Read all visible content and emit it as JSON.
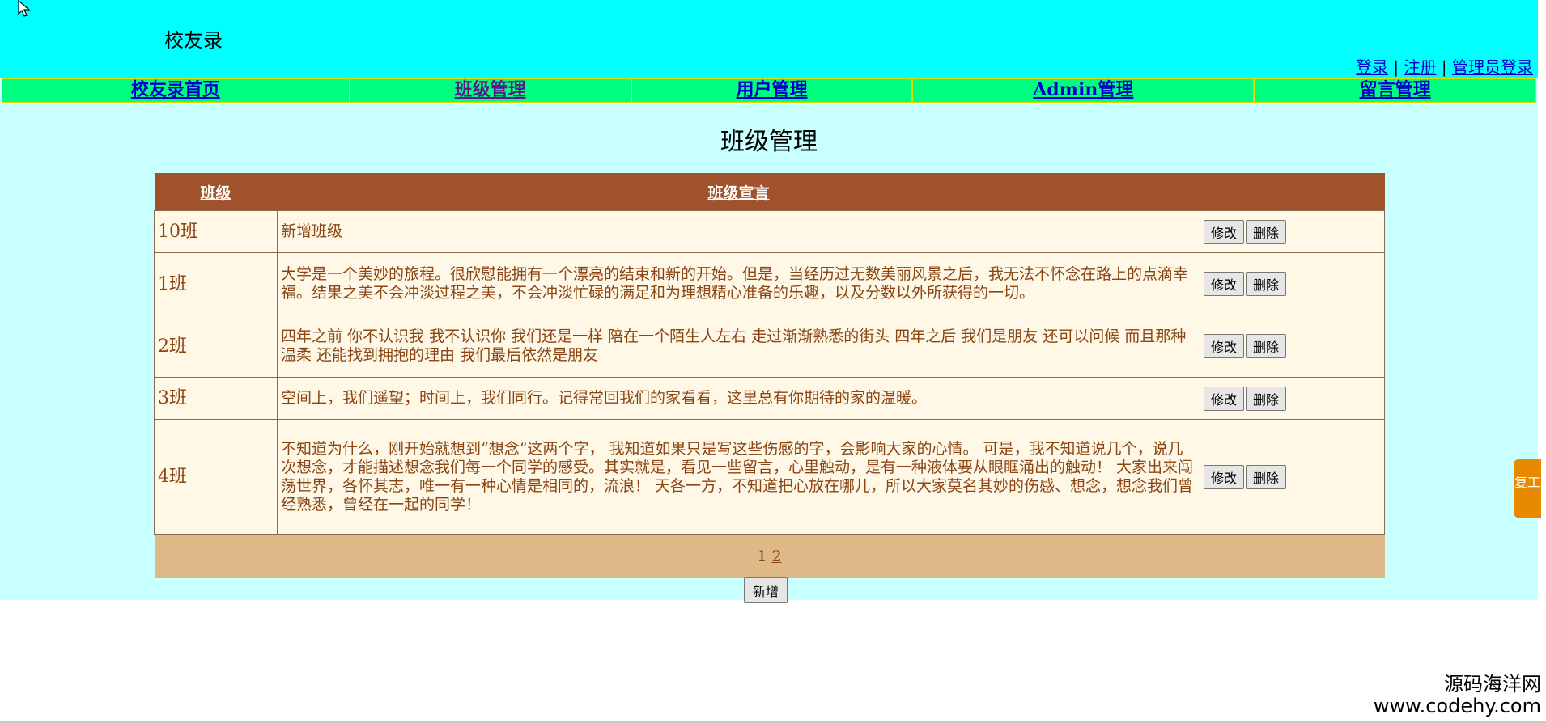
{
  "header": {
    "title": "校友录",
    "auth_links": [
      {
        "label": "登录"
      },
      {
        "label": "注册"
      },
      {
        "label": "管理员登录"
      }
    ],
    "separator": "|"
  },
  "nav": {
    "items": [
      {
        "label": "校友录首页",
        "visited": false
      },
      {
        "label": "班级管理",
        "visited": true
      },
      {
        "label": "用户管理",
        "visited": false
      },
      {
        "label": "Admin管理",
        "visited": false
      },
      {
        "label": "留言管理",
        "visited": false
      }
    ]
  },
  "page": {
    "title": "班级管理"
  },
  "table": {
    "headers": {
      "class": "班级",
      "motto": "班级宣言",
      "actions": ""
    },
    "rows": [
      {
        "class": "10班",
        "motto": "新增班级"
      },
      {
        "class": "1班",
        "motto": "大学是一个美妙的旅程。很欣慰能拥有一个漂亮的结束和新的开始。但是，当经历过无数美丽风景之后，我无法不怀念在路上的点滴幸福。结果之美不会冲淡过程之美，不会冲淡忙碌的满足和为理想精心准备的乐趣，以及分数以外所获得的一切。"
      },
      {
        "class": "2班",
        "motto": "四年之前 你不认识我 我不认识你 我们还是一样 陪在一个陌生人左右 走过渐渐熟悉的街头 四年之后 我们是朋友 还可以问候 而且那种温柔 还能找到拥抱的理由 我们最后依然是朋友"
      },
      {
        "class": "3班",
        "motto": "空间上，我们遥望；时间上，我们同行。记得常回我们的家看看，这里总有你期待的家的温暖。"
      },
      {
        "class": "4班",
        "motto": "不知道为什么，刚开始就想到“想念”这两个字， 我知道如果只是写这些伤感的字，会影响大家的心情。 可是，我不知道说几个，说几次想念，才能描述想念我们每一个同学的感受。其实就是，看见一些留言，心里触动，是有一种液体要从眼眶涌出的触动！ 大家出来闯荡世界，各怀其志，唯一有一种心情是相同的，流浪！ 天各一方，不知道把心放在哪儿，所以大家莫名其妙的伤感、想念，想念我们曾经熟悉，曾经在一起的同学！"
      }
    ],
    "edit_label": "修改",
    "delete_label": "删除",
    "pager": {
      "current": "1",
      "next": "2"
    }
  },
  "add_button_label": "新增",
  "side_widget": {
    "text": "复工"
  },
  "watermark": {
    "name": "源码海洋网",
    "url": "www.codehy.com"
  },
  "colors": {
    "header_bg": "#00ffff",
    "page_bg": "#c8ffff",
    "nav_bg": "#00ff80",
    "table_header_bg": "#a0522d",
    "row_bg": "#fff8e7",
    "pager_bg": "#deb887",
    "text_brown": "#8b4513"
  }
}
